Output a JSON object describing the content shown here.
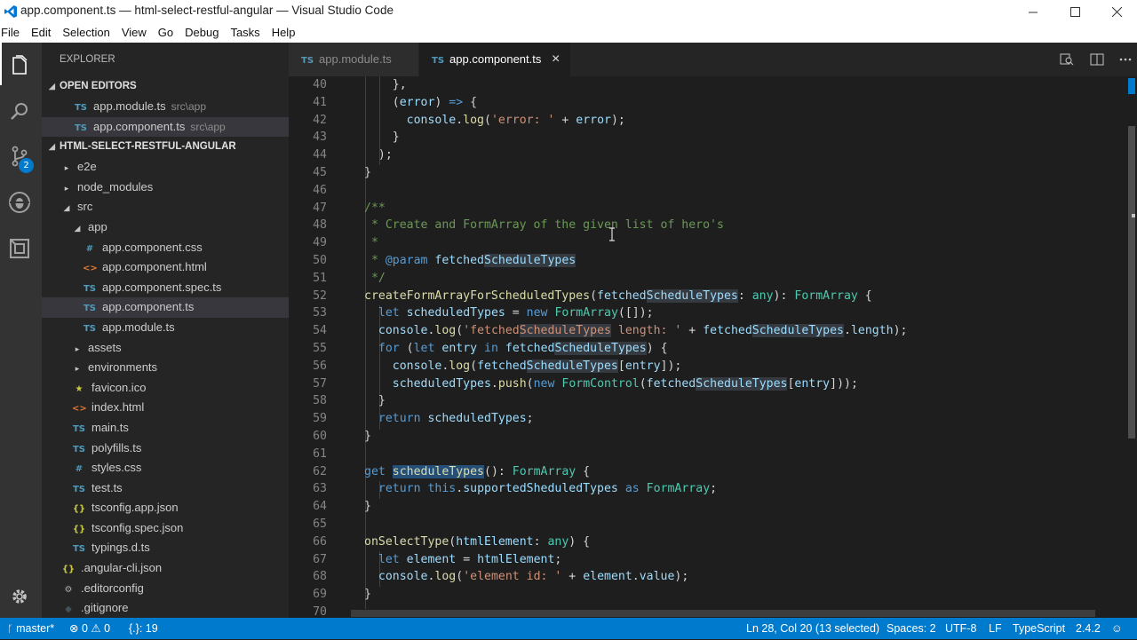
{
  "window": {
    "title": "app.component.ts — html-select-restful-angular — Visual Studio Code"
  },
  "menu": [
    "File",
    "Edit",
    "Selection",
    "View",
    "Go",
    "Debug",
    "Tasks",
    "Help"
  ],
  "explorer": {
    "header": "EXPLORER",
    "open_editors_label": "OPEN EDITORS",
    "open_editors": [
      {
        "icon": "TS",
        "name": "app.module.ts",
        "desc": "src\\app"
      },
      {
        "icon": "TS",
        "name": "app.component.ts",
        "desc": "src\\app"
      }
    ],
    "project_label": "HTML-SELECT-RESTFUL-ANGULAR",
    "tree": [
      {
        "name": "e2e",
        "icon": "▸"
      },
      {
        "name": "node_modules",
        "icon": "▸"
      },
      {
        "name": "src",
        "icon": "◢"
      },
      {
        "name": "app",
        "icon": "◢"
      },
      {
        "name": "app.component.css",
        "icon": "#"
      },
      {
        "name": "app.component.html",
        "icon": "<>"
      },
      {
        "name": "app.component.spec.ts",
        "icon": "TS"
      },
      {
        "name": "app.component.ts",
        "icon": "TS"
      },
      {
        "name": "app.module.ts",
        "icon": "TS"
      },
      {
        "name": "assets",
        "icon": "▸"
      },
      {
        "name": "environments",
        "icon": "▸"
      },
      {
        "name": "favicon.ico",
        "icon": "★"
      },
      {
        "name": "index.html",
        "icon": "<>"
      },
      {
        "name": "main.ts",
        "icon": "TS"
      },
      {
        "name": "polyfills.ts",
        "icon": "TS"
      },
      {
        "name": "styles.css",
        "icon": "#"
      },
      {
        "name": "test.ts",
        "icon": "TS"
      },
      {
        "name": "tsconfig.app.json",
        "icon": "{}"
      },
      {
        "name": "tsconfig.spec.json",
        "icon": "{}"
      },
      {
        "name": "typings.d.ts",
        "icon": "TS"
      },
      {
        "name": ".angular-cli.json",
        "icon": "{}"
      },
      {
        "name": ".editorconfig",
        "icon": "⚙"
      },
      {
        "name": ".gitignore",
        "icon": "◆"
      }
    ]
  },
  "activity": {
    "scm_badge": "2"
  },
  "tabs": [
    {
      "icon": "TS",
      "label": "app.module.ts"
    },
    {
      "icon": "TS",
      "label": "app.component.ts",
      "close": "×"
    }
  ],
  "editor": {
    "line_numbers": [
      "40",
      "41",
      "42",
      "43",
      "44",
      "45",
      "46",
      "47",
      "48",
      "49",
      "50",
      "51",
      "52",
      "53",
      "54",
      "55",
      "56",
      "57",
      "58",
      "59",
      "60",
      "61",
      "62",
      "63",
      "64",
      "65",
      "66",
      "67",
      "68",
      "69",
      "70"
    ]
  },
  "status": {
    "branch": "master*",
    "errors": "0",
    "warnings": "0",
    "symbol": "{.}: 19",
    "position": "Ln 28, Col 20 (13 selected)",
    "spaces": "Spaces: 2",
    "encoding": "UTF-8",
    "eol": "LF",
    "language": "TypeScript",
    "version": "2.4.2"
  },
  "colors": {
    "accent": "#007acc",
    "sidebar": "#252526",
    "editor": "#1e1e1e",
    "activity": "#333333"
  }
}
